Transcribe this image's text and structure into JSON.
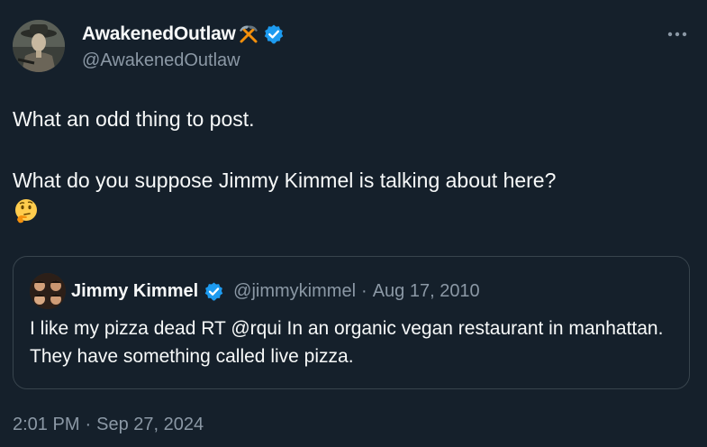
{
  "author": {
    "display_name": "AwakenedOutlaw",
    "handle": "@AwakenedOutlaw",
    "name_icons": [
      "pick-axe-icon",
      "verified-badge-icon"
    ]
  },
  "tweet": {
    "line1": "What an odd thing to post.",
    "line2": "What do you suppose Jimmy Kimmel is talking about here?",
    "emoji": "thinking-face-icon"
  },
  "quoted": {
    "display_name": "Jimmy Kimmel",
    "handle": "@jimmykimmel",
    "separator": "·",
    "date": "Aug 17, 2010",
    "text": "I like my pizza dead RT @rqui In an organic vegan restaurant in manhattan. They have something called live pizza."
  },
  "meta": {
    "time": "2:01 PM",
    "separator": "·",
    "date": "Sep 27, 2024"
  },
  "colors": {
    "background": "#15202b",
    "text_primary": "#f7f9f9",
    "text_secondary": "#8b98a5",
    "border": "#38444d",
    "verified": "#1d9bf0",
    "pick_axe": "#f4900c"
  }
}
